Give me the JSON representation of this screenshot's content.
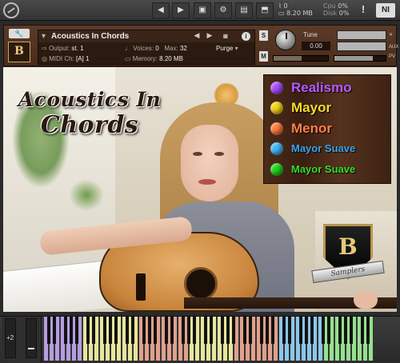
{
  "topbar": {
    "cpu_label": "Cpu",
    "cpu_value": "0%",
    "disk_label": "Disk",
    "disk_value": "0%",
    "voices_value": "0",
    "memory_value": "8.20 MB",
    "warning": "!",
    "ni_logo": "NI"
  },
  "header": {
    "instrument_name": "Acoustics In Chords",
    "output_label": "Output:",
    "output_value": "st. 1",
    "voices_label": "Voices:",
    "voices_value": "0",
    "max_label": "Max:",
    "max_value": "32",
    "purge_label": "Purge",
    "midi_label": "MIDI Ch:",
    "midi_value": "[A]  1",
    "memory_label": "Memory:",
    "memory_value": "8.20 MB",
    "solo": "S",
    "mute": "M",
    "tune_label": "Tune",
    "tune_value": "0.00",
    "aux_label": "AUX",
    "pv_label": "PV",
    "pan_label": "L  ◦  R"
  },
  "artwork": {
    "title_line1": "Acoustics In",
    "title_line2": "Chords",
    "emblem_letter": "B",
    "emblem_ribbon": "Samplers"
  },
  "legend": {
    "items": [
      {
        "label": "Realismo",
        "dot_color": "#a94dff",
        "text_color": "#b45cff"
      },
      {
        "label": "Mayor",
        "dot_color": "#f1d417",
        "text_color": "#f5dc2a"
      },
      {
        "label": "Menor",
        "dot_color": "#ff7a3a",
        "text_color": "#ff7f45"
      },
      {
        "label": "Mayor Suave",
        "dot_color": "#3fb6f5",
        "text_color": "#3aa5ec"
      },
      {
        "label": "Mayor Suave",
        "dot_color": "#21d31d",
        "text_color": "#34db2c"
      }
    ]
  },
  "keyboard": {
    "octave_label": "+2",
    "zones": [
      {
        "name": "Realismo",
        "color": "#b49de0"
      },
      {
        "name": "Mayor",
        "color": "#e6e69c"
      },
      {
        "name": "Menor",
        "color": "#e0a08c"
      },
      {
        "name": "Mayor",
        "color": "#e6e69c"
      },
      {
        "name": "Menor",
        "color": "#e0a08c"
      },
      {
        "name": "Mayor Suave",
        "color": "#8cc6ea"
      },
      {
        "name": "Mayor Suave",
        "color": "#95e08e"
      }
    ]
  }
}
